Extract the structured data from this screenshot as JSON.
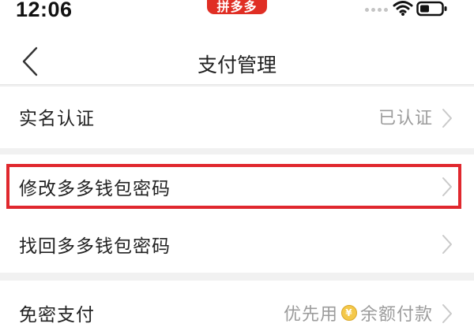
{
  "status_bar": {
    "time": "12:06",
    "app_badge": "拼多多"
  },
  "nav": {
    "title": "支付管理"
  },
  "rows": [
    {
      "label": "实名认证",
      "value": "已认证"
    },
    {
      "label": "修改多多钱包密码",
      "value": "",
      "highlighted": true
    },
    {
      "label": "找回多多钱包密码",
      "value": ""
    },
    {
      "label": "免密支付",
      "value_prefix": "优先用",
      "value_suffix": "余额付款"
    }
  ],
  "colors": {
    "brand": "#e02e24",
    "highlight": "#e0282e",
    "secondary_text": "#9c9c9c",
    "background": "#f1f1f1"
  },
  "icons": {
    "back": "chevron-left-icon",
    "row_arrow": "chevron-right-icon",
    "coin": "coin-icon",
    "wifi": "wifi-icon",
    "battery": "battery-icon"
  }
}
